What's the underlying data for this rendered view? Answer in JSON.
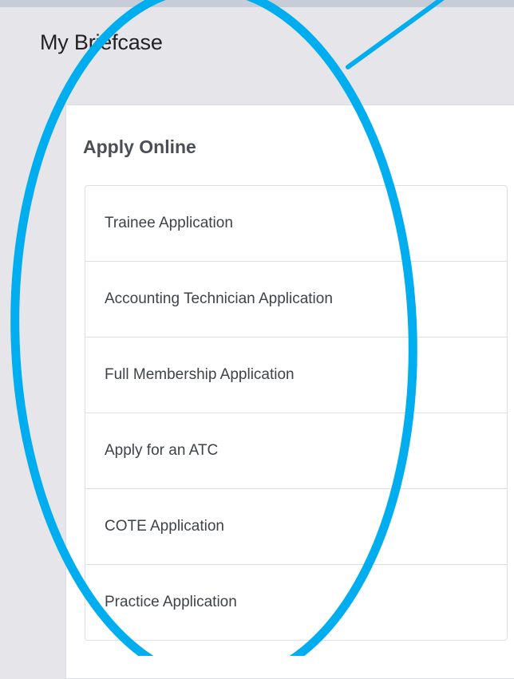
{
  "header": {
    "title": "My Briefcase"
  },
  "panel": {
    "heading": "Apply Online",
    "items": [
      {
        "label": "Trainee Application"
      },
      {
        "label": "Accounting Technician Application"
      },
      {
        "label": "Full Membership Application"
      },
      {
        "label": "Apply for an ATC"
      },
      {
        "label": "COTE Application"
      },
      {
        "label": "Practice Application"
      }
    ]
  },
  "colors": {
    "page_background": "#e6e6ea",
    "panel_background": "#ffffff",
    "annotation_highlight": "#00aeef"
  }
}
